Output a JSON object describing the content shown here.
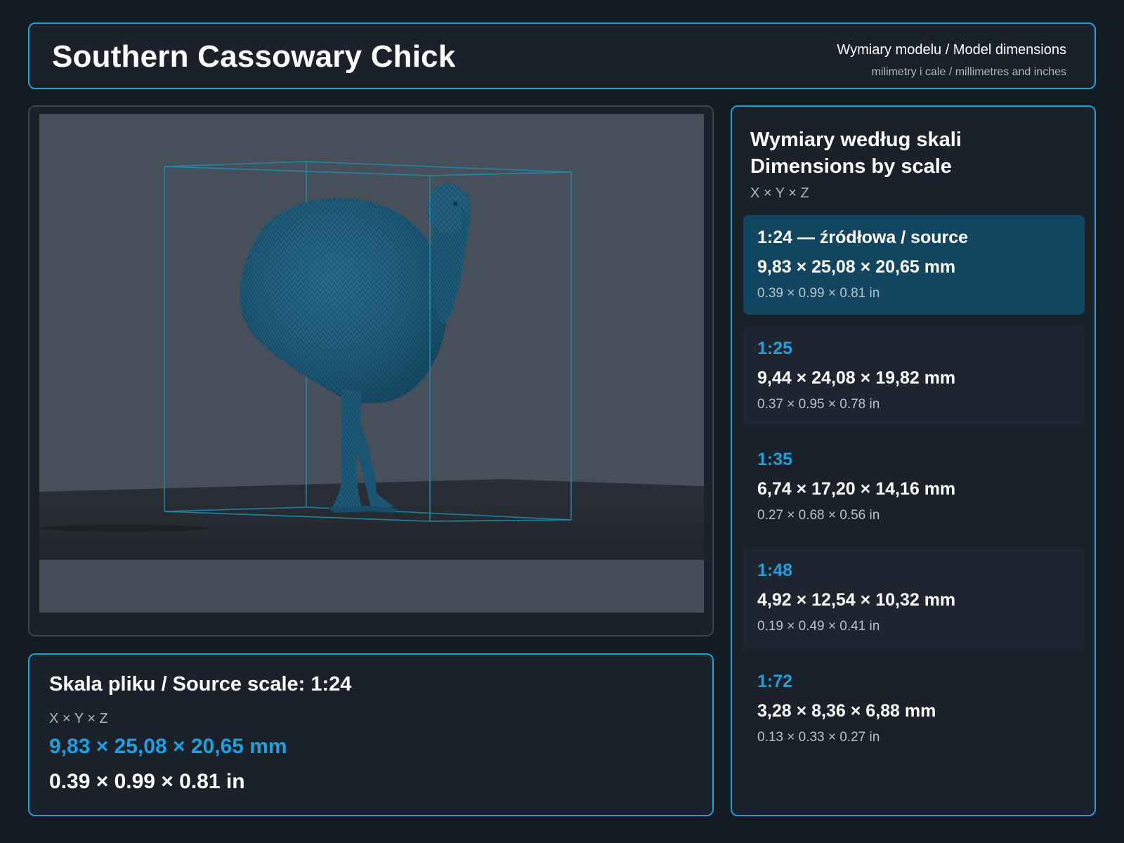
{
  "header": {
    "title": "Southern Cassowary Chick",
    "subtitle": "Wymiary modelu / Model dimensions",
    "units_note": "milimetry i cale / millimetres and inches"
  },
  "source": {
    "title": "Skala pliku / Source scale: 1:24",
    "axes": "X × Y × Z",
    "mm": "9,83 × 25,08 × 20,65 mm",
    "in": "0.39 × 0.99 × 0.81 in"
  },
  "scales": {
    "title_pl": "Wymiary według skali",
    "title_en": "Dimensions by scale",
    "axes": "X × Y × Z",
    "items": [
      {
        "label": "1:24  —  źródłowa / source",
        "mm": "9,83 × 25,08 × 20,65 mm",
        "in": "0.39 × 0.99 × 0.81 in"
      },
      {
        "label": "1:25",
        "mm": "9,44 × 24,08 × 19,82 mm",
        "in": "0.37 × 0.95 × 0.78 in"
      },
      {
        "label": "1:35",
        "mm": "6,74 × 17,20 × 14,16 mm",
        "in": "0.27 × 0.68 × 0.56 in"
      },
      {
        "label": "1:48",
        "mm": "4,92 × 12,54 × 10,32 mm",
        "in": "0.19 × 0.49 × 0.41 in"
      },
      {
        "label": "1:72",
        "mm": "3,28 × 8,36 × 6,88 mm",
        "in": "0.13 × 0.33 × 0.27 in"
      }
    ]
  },
  "colors": {
    "accent": "#1ea0dc",
    "panel": "#1b212a",
    "background": "#141a22",
    "active_card": "#124660",
    "model": "#1d5a78"
  }
}
